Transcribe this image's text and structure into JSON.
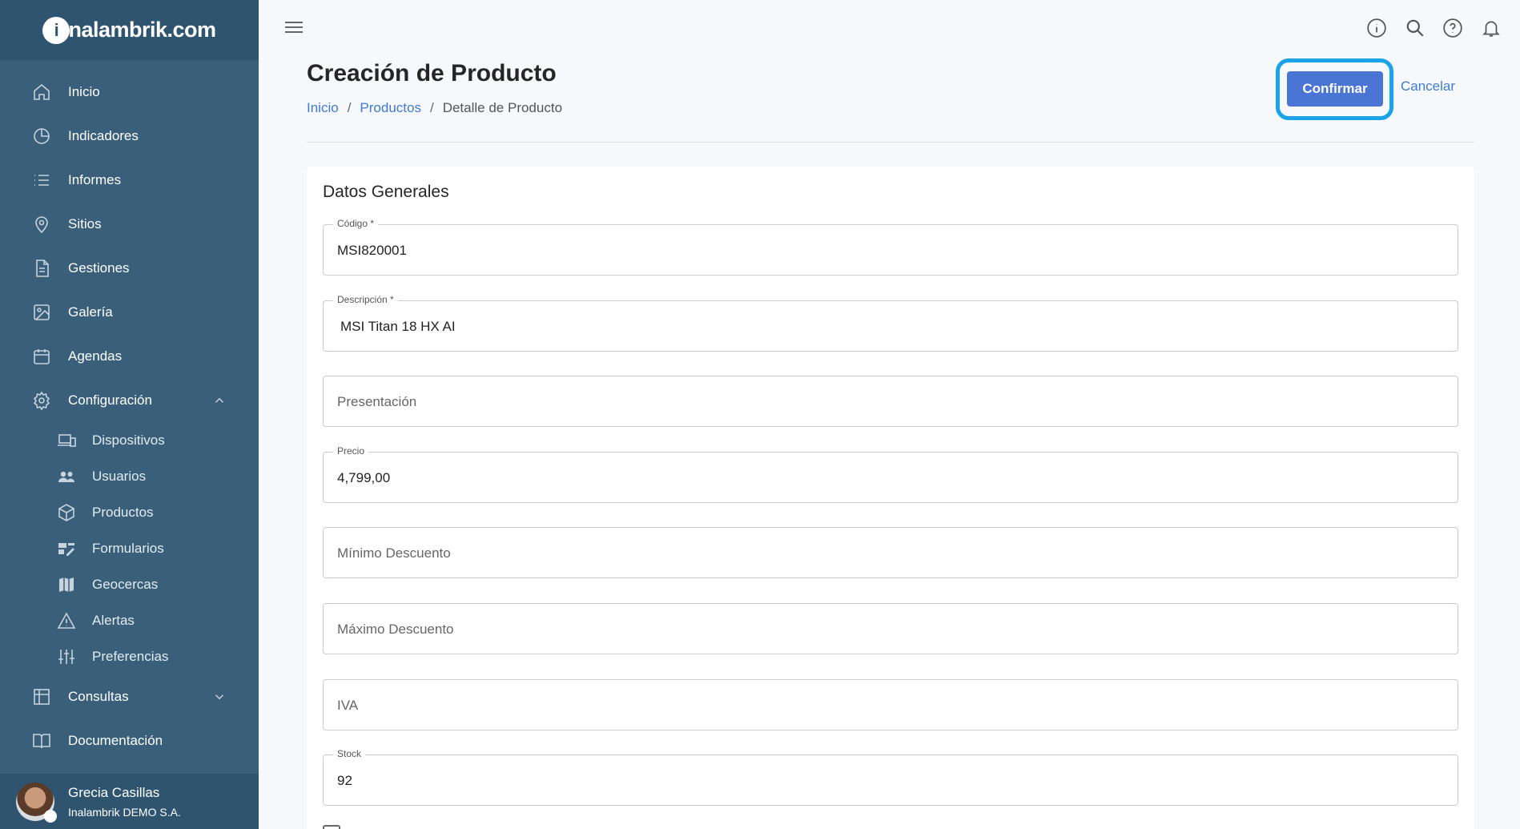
{
  "app": {
    "logo_text": "nalambrik.com",
    "logo_letter": "i"
  },
  "sidebar": {
    "items": [
      {
        "label": "Inicio",
        "icon": "home-icon"
      },
      {
        "label": "Indicadores",
        "icon": "pie-chart-icon"
      },
      {
        "label": "Informes",
        "icon": "list-icon"
      },
      {
        "label": "Sitios",
        "icon": "map-pin-icon"
      },
      {
        "label": "Gestiones",
        "icon": "document-icon"
      },
      {
        "label": "Galería",
        "icon": "image-icon"
      },
      {
        "label": "Agendas",
        "icon": "calendar-icon"
      },
      {
        "label": "Configuración",
        "icon": "gear-icon",
        "expanded": true
      },
      {
        "label": "Consultas",
        "icon": "table-icon",
        "expanded": false
      },
      {
        "label": "Documentación",
        "icon": "book-icon"
      }
    ],
    "config_subitems": [
      {
        "label": "Dispositivos",
        "icon": "devices-icon"
      },
      {
        "label": "Usuarios",
        "icon": "users-icon"
      },
      {
        "label": "Productos",
        "icon": "box-icon"
      },
      {
        "label": "Formularios",
        "icon": "form-icon"
      },
      {
        "label": "Geocercas",
        "icon": "map-icon"
      },
      {
        "label": "Alertas",
        "icon": "warning-icon"
      },
      {
        "label": "Preferencias",
        "icon": "sliders-icon"
      }
    ],
    "user": {
      "name": "Grecia Casillas",
      "org": "Inalambrik DEMO S.A."
    }
  },
  "header": {
    "title": "Creación de Producto",
    "breadcrumb": [
      "Inicio",
      "Productos",
      "Detalle de Producto"
    ],
    "breadcrumb_sep": "/",
    "confirm_label": "Confirmar",
    "cancel_label": "Cancelar"
  },
  "form": {
    "section_title": "Datos Generales",
    "fields": [
      {
        "label": "Código *",
        "value": "MSI820001"
      },
      {
        "label": "Descripción *",
        "value": "MSI Titan 18 HX AI"
      },
      {
        "placeholder": "Presentación"
      },
      {
        "label": "Precio",
        "value": "4,799,00"
      },
      {
        "placeholder": "Mínimo Descuento"
      },
      {
        "placeholder": "Máximo Descuento"
      },
      {
        "placeholder": "IVA"
      },
      {
        "label": "Stock",
        "value": "92"
      }
    ]
  },
  "colors": {
    "sidebar": "#3a5f7a",
    "sidebar_dark": "#2f5470",
    "accent": "#4a75d4",
    "highlight": "#1aa3e8",
    "link": "#3f7bd1"
  }
}
